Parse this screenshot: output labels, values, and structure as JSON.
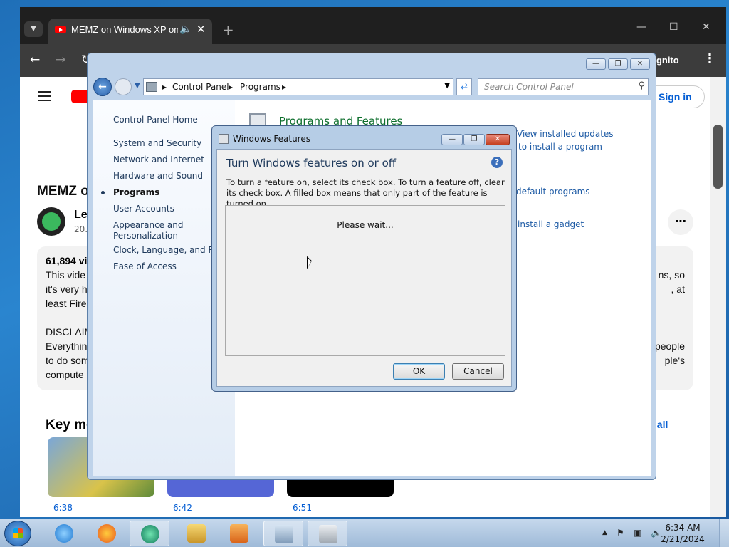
{
  "browser": {
    "tab_title": "MEMZ on Windows XP on",
    "incognito_label": "ognito",
    "youtube": {
      "signin": "Sign in",
      "video_title_fragment": "MEMZ o",
      "channel_fragment": "Le",
      "subs_fragment": "20.",
      "views_fragment": "61,894 vi",
      "desc_left": [
        "This vide",
        "it's very h",
        "least Fire",
        "",
        "DISCLAIM",
        "Everythin",
        "to do som",
        "compute"
      ],
      "desc_right": [
        "ns, so",
        ", at",
        "",
        "",
        "",
        "people",
        "ple's",
        ""
      ],
      "key_moments_fragment": "Key mo",
      "view_all_fragment": "w all",
      "durations": [
        "6:38",
        "6:42",
        "6:51"
      ]
    }
  },
  "control_panel": {
    "breadcrumb": [
      "Control Panel",
      "Programs"
    ],
    "search_placeholder": "Search Control Panel",
    "home_link": "Control Panel Home",
    "nav_links": [
      "System and Security",
      "Network and Internet",
      "Hardware and Sound",
      "Programs",
      "User Accounts",
      "Appearance and",
      "Personalization",
      "Clock, Language, and Reg",
      "Ease of Access"
    ],
    "active_link": "Programs",
    "section_title": "Programs and Features",
    "tasks": [
      "View installed updates",
      "to install a program",
      "default programs",
      "install a gadget"
    ]
  },
  "dialog": {
    "window_title": "Windows Features",
    "heading": "Turn Windows features on or off",
    "description": "To turn a feature on, select its check box. To turn a feature off, clear its check box. A filled box means that only part of the feature is turned on.",
    "status": "Please wait...",
    "ok_label": "OK",
    "cancel_label": "Cancel"
  },
  "taskbar": {
    "time": "6:34 AM",
    "date": "2/21/2024"
  },
  "colors": {
    "link_blue": "#1e395b",
    "section_green": "#0e6f2d",
    "youtube_red": "#ff0000"
  }
}
